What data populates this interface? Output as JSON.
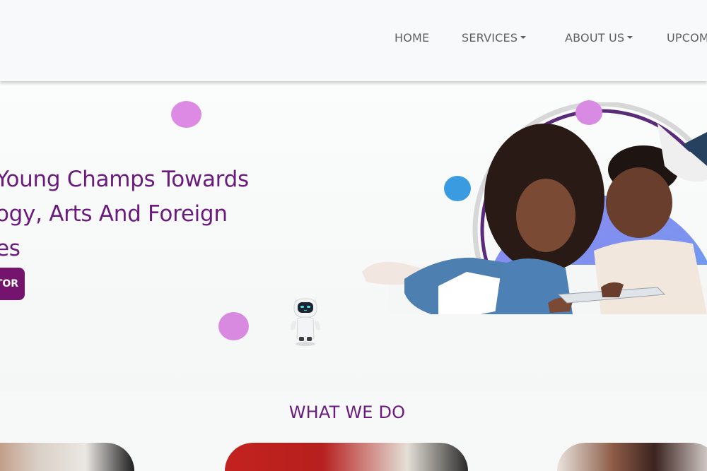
{
  "nav": {
    "items": [
      {
        "label": "HOME",
        "has_dropdown": false
      },
      {
        "label": "SERVICES",
        "has_dropdown": true
      },
      {
        "label": "ABOUT US",
        "has_dropdown": true
      },
      {
        "label": "UPCOM",
        "has_dropdown": false
      }
    ]
  },
  "hero": {
    "headline_lines": [
      "Young Champs Towards",
      "ogy, Arts And Foreign",
      "es"
    ],
    "cta_label": "TOR",
    "robot_icon": "robot-mascot",
    "colors": {
      "brand_purple": "#6a1b7d",
      "cta_bg": "#74146f",
      "dot_pink": "#dc8ae4",
      "dot_blue": "#3a9be0"
    }
  },
  "what_we_do": {
    "title": "WHAT WE DO"
  }
}
